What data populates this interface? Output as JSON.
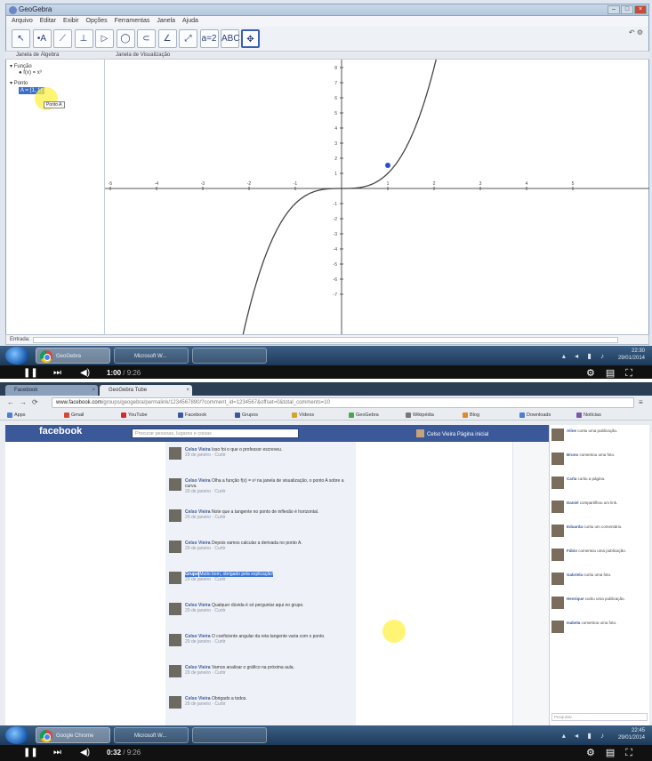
{
  "geogebra": {
    "title": "GeoGebra",
    "menu": [
      "Arquivo",
      "Editar",
      "Exibir",
      "Opções",
      "Ferramentas",
      "Janela",
      "Ajuda"
    ],
    "tools": [
      {
        "id": "move",
        "glyph": "↖",
        "icon": "move-tool-icon"
      },
      {
        "id": "point",
        "glyph": "•A",
        "icon": "point-tool-icon"
      },
      {
        "id": "line",
        "glyph": "⟋",
        "icon": "line-tool-icon"
      },
      {
        "id": "perpendicular",
        "glyph": "⊥",
        "icon": "perpendicular-tool-icon"
      },
      {
        "id": "polygon",
        "glyph": "▷",
        "icon": "polygon-tool-icon"
      },
      {
        "id": "circle",
        "glyph": "◯",
        "icon": "circle-tool-icon"
      },
      {
        "id": "conic",
        "glyph": "⊂",
        "icon": "conic-tool-icon"
      },
      {
        "id": "angle",
        "glyph": "∠",
        "icon": "angle-tool-icon"
      },
      {
        "id": "reflect",
        "glyph": "⤢",
        "icon": "reflect-tool-icon"
      },
      {
        "id": "slider",
        "glyph": "a=2",
        "icon": "slider-tool-icon"
      },
      {
        "id": "text",
        "glyph": "ABC",
        "icon": "text-tool-icon"
      },
      {
        "id": "move-view",
        "glyph": "✥",
        "icon": "move-view-tool-icon",
        "active": true
      }
    ],
    "algebra_header": "Janela de Álgebra",
    "graphics_header": "Janela de Visualização",
    "algebra": {
      "group_function": "Função",
      "function_entry": "f(x) = x³",
      "group_point": "Ponto",
      "point_entry": "A = (1, 1)",
      "tooltip": "Ponto A"
    },
    "axes": {
      "x_ticks": [
        "-5",
        "-4",
        "-3",
        "-2",
        "-1",
        "1",
        "2",
        "3",
        "4",
        "5"
      ],
      "y_ticks": [
        "8",
        "7",
        "6",
        "5",
        "4",
        "3",
        "2",
        "1",
        "-1",
        "-2",
        "-3",
        "-4",
        "-5",
        "-6",
        "-7"
      ]
    },
    "input_label": "Entrada:"
  },
  "taskbar_top": {
    "items": [
      "GeoGebra",
      "Microsoft W...",
      ""
    ],
    "clock_time": "22:30",
    "clock_date": "29/01/2014"
  },
  "player_top": {
    "time_current": "1:00",
    "time_total": "9:26"
  },
  "browser": {
    "tabs": [
      "Facebook",
      "GeoGebra Tube"
    ],
    "url_host": "www.facebook.com",
    "url_path": "/groups/geogebra/permalink/1234567890/?comment_id=1234567&offset=0&total_comments=10",
    "bookmarks": [
      {
        "label": "Apps",
        "color": "#4a7fd4"
      },
      {
        "label": "Gmail",
        "color": "#d44a3a"
      },
      {
        "label": "YouTube",
        "color": "#d42a2a"
      },
      {
        "label": "Facebook",
        "color": "#3b5998"
      },
      {
        "label": "Grupos",
        "color": "#3b5998"
      },
      {
        "label": "Vídeos",
        "color": "#d4a32a"
      },
      {
        "label": "GeoGebra",
        "color": "#4aa84a"
      },
      {
        "label": "Wikipédia",
        "color": "#777777"
      },
      {
        "label": "Blog",
        "color": "#e08a2a"
      },
      {
        "label": "Downloads",
        "color": "#4a7fd4"
      },
      {
        "label": "Notícias",
        "color": "#7a5aa8"
      }
    ]
  },
  "facebook": {
    "logo": "facebook",
    "search_placeholder": "Procurar pessoas, lugares e coisas",
    "user_name": "Celso Vieira",
    "user_links": "Página inicial",
    "comments": [
      {
        "name": "Celso Vieira",
        "body": "Isso foi o que o professor escreveu.",
        "meta": "29 de janeiro · Curtir"
      },
      {
        "name": "Celso Vieira",
        "body": "Olha a função f(x) = x³ na janela de visualização, o ponto A sobre a curva.",
        "meta": "29 de janeiro · Curtir"
      },
      {
        "name": "Celso Vieira",
        "body": "Note que a tangente no ponto de inflexão é horizontal.",
        "meta": "29 de janeiro · Curtir"
      },
      {
        "name": "Celso Vieira",
        "body": "Depois vamos calcular a derivada no ponto A.",
        "meta": "29 de janeiro · Curtir"
      },
      {
        "name": "Grupo",
        "body": "Muito bom, obrigado pela explicação!",
        "meta": "29 de janeiro · Curtir",
        "selected": true
      },
      {
        "name": "Celso Vieira",
        "body": "Qualquer dúvida é só perguntar aqui no grupo.",
        "meta": "29 de janeiro · Curtir"
      },
      {
        "name": "Celso Vieira",
        "body": "O coeficiente angular da reta tangente varia com o ponto.",
        "meta": "29 de janeiro · Curtir"
      },
      {
        "name": "Celso Vieira",
        "body": "Vamos analisar o gráfico na próxima aula.",
        "meta": "29 de janeiro · Curtir"
      },
      {
        "name": "Celso Vieira",
        "body": "Obrigado a todos.",
        "meta": "29 de janeiro · Curtir"
      }
    ],
    "ticker": [
      {
        "name": "Aline",
        "text": "curtiu uma publicação."
      },
      {
        "name": "Bruno",
        "text": "comentou uma foto."
      },
      {
        "name": "Carla",
        "text": "curtiu a página."
      },
      {
        "name": "Daniel",
        "text": "compartilhou um link."
      },
      {
        "name": "Eduarda",
        "text": "curtiu um comentário."
      },
      {
        "name": "Fábio",
        "text": "comentou uma publicação."
      },
      {
        "name": "Gabriela",
        "text": "curtiu uma foto."
      },
      {
        "name": "Henrique",
        "text": "curtiu uma publicação."
      },
      {
        "name": "Isabela",
        "text": "comentou uma foto."
      }
    ],
    "chat_search": "Pesquisar"
  },
  "taskbar_bottom": {
    "items": [
      "Google Chrome",
      "Microsoft W...",
      ""
    ],
    "clock_time": "22:45",
    "clock_date": "29/01/2014"
  },
  "player_bottom": {
    "time_current": "0:32",
    "time_total": "9:26"
  }
}
